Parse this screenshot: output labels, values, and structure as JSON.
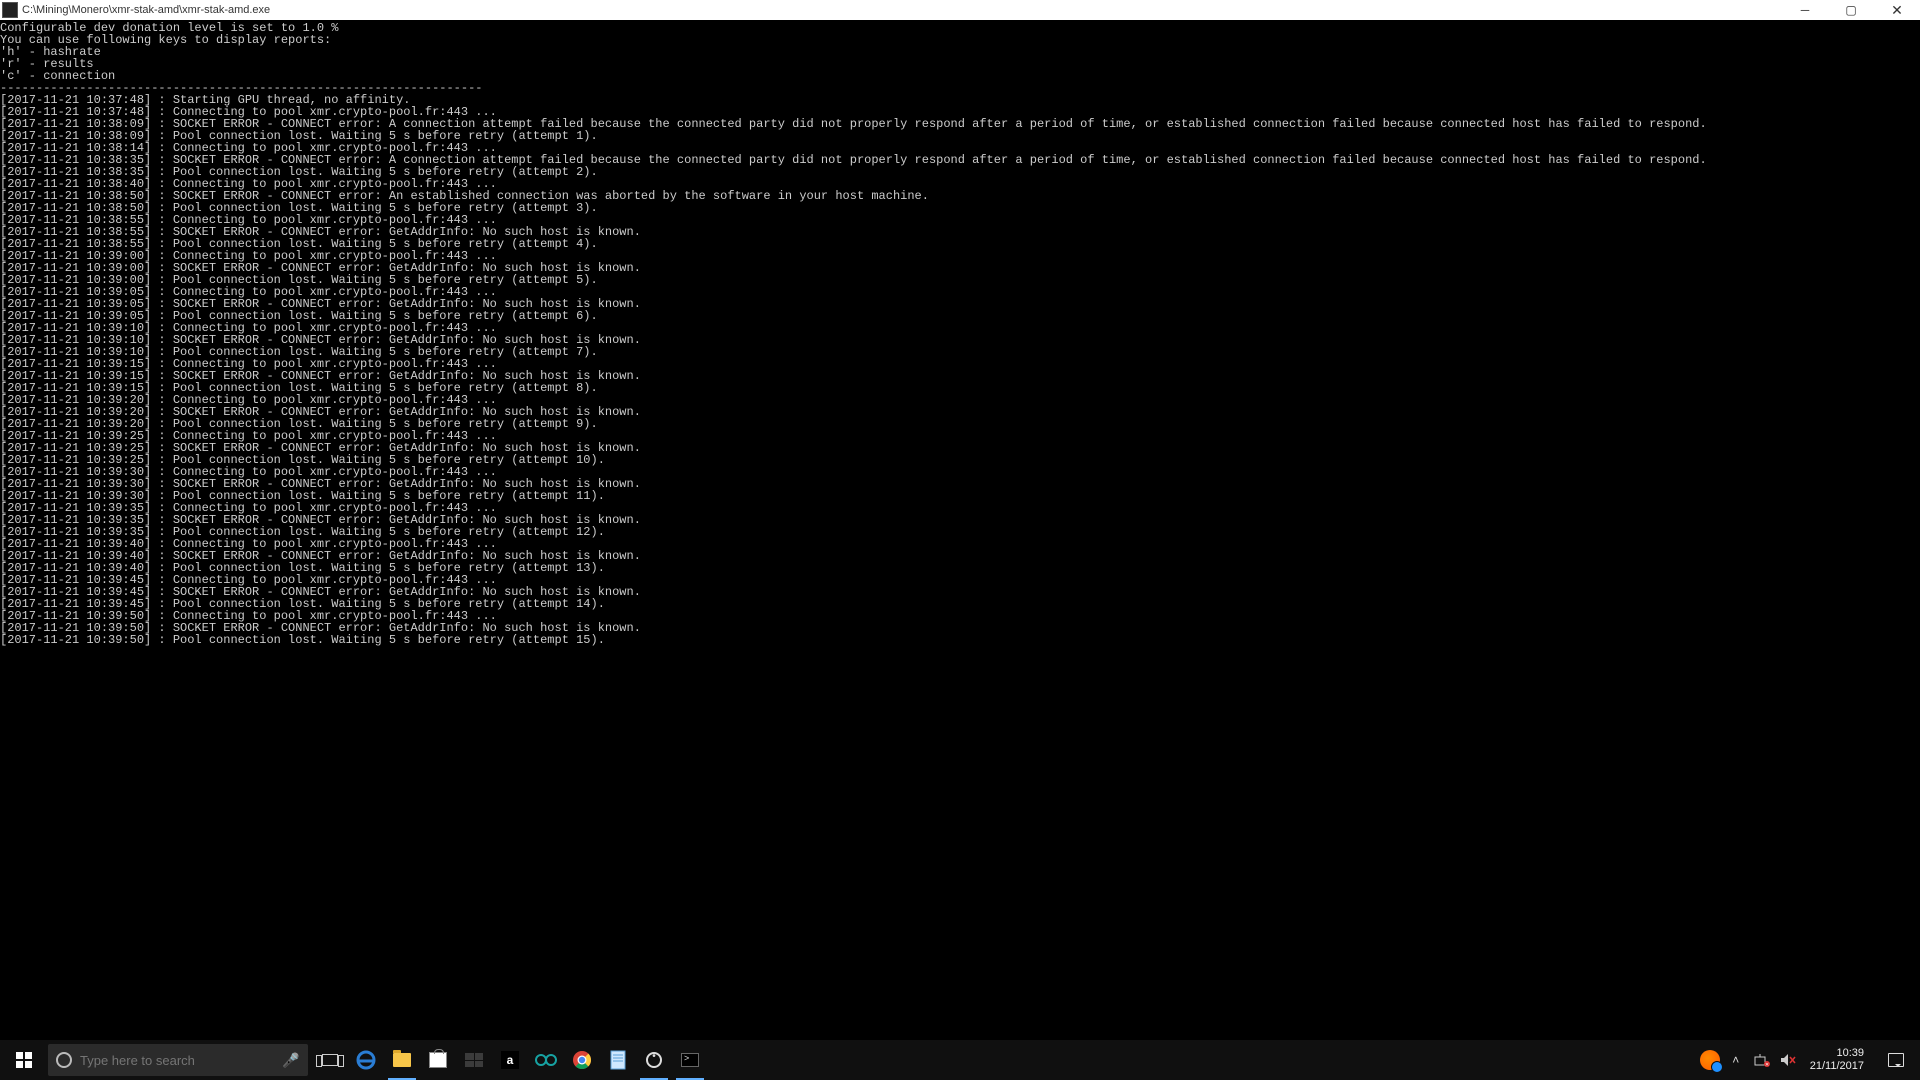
{
  "window": {
    "title": "C:\\Mining\\Monero\\xmr-stak-amd\\xmr-stak-amd.exe"
  },
  "console": {
    "header": [
      "Configurable dev donation level is set to 1.0 %",
      "",
      "You can use following keys to display reports:",
      "'h' - hashrate",
      "'r' - results",
      "'c' - connection",
      "-------------------------------------------------------------------"
    ],
    "log": [
      {
        "ts": "2017-11-21 10:37:48",
        "msg": "Starting GPU thread, no affinity."
      },
      {
        "ts": "2017-11-21 10:37:48",
        "msg": "Connecting to pool xmr.crypto-pool.fr:443 ..."
      },
      {
        "ts": "2017-11-21 10:38:09",
        "msg": "SOCKET ERROR - CONNECT error: A connection attempt failed because the connected party did not properly respond after a period of time, or established connection failed because connected host has failed to respond."
      },
      {
        "ts": "",
        "msg": ""
      },
      {
        "ts": "2017-11-21 10:38:09",
        "msg": "Pool connection lost. Waiting 5 s before retry (attempt 1)."
      },
      {
        "ts": "2017-11-21 10:38:14",
        "msg": "Connecting to pool xmr.crypto-pool.fr:443 ..."
      },
      {
        "ts": "2017-11-21 10:38:35",
        "msg": "SOCKET ERROR - CONNECT error: A connection attempt failed because the connected party did not properly respond after a period of time, or established connection failed because connected host has failed to respond."
      },
      {
        "ts": "",
        "msg": ""
      },
      {
        "ts": "2017-11-21 10:38:35",
        "msg": "Pool connection lost. Waiting 5 s before retry (attempt 2)."
      },
      {
        "ts": "2017-11-21 10:38:40",
        "msg": "Connecting to pool xmr.crypto-pool.fr:443 ..."
      },
      {
        "ts": "2017-11-21 10:38:50",
        "msg": "SOCKET ERROR - CONNECT error: An established connection was aborted by the software in your host machine."
      },
      {
        "ts": "2017-11-21 10:38:50",
        "msg": "Pool connection lost. Waiting 5 s before retry (attempt 3)."
      },
      {
        "ts": "2017-11-21 10:38:55",
        "msg": "Connecting to pool xmr.crypto-pool.fr:443 ..."
      },
      {
        "ts": "2017-11-21 10:38:55",
        "msg": "SOCKET ERROR - CONNECT error: GetAddrInfo: No such host is known."
      },
      {
        "ts": "2017-11-21 10:38:55",
        "msg": "Pool connection lost. Waiting 5 s before retry (attempt 4)."
      },
      {
        "ts": "2017-11-21 10:39:00",
        "msg": "Connecting to pool xmr.crypto-pool.fr:443 ..."
      },
      {
        "ts": "2017-11-21 10:39:00",
        "msg": "SOCKET ERROR - CONNECT error: GetAddrInfo: No such host is known."
      },
      {
        "ts": "2017-11-21 10:39:00",
        "msg": "Pool connection lost. Waiting 5 s before retry (attempt 5)."
      },
      {
        "ts": "2017-11-21 10:39:05",
        "msg": "Connecting to pool xmr.crypto-pool.fr:443 ..."
      },
      {
        "ts": "2017-11-21 10:39:05",
        "msg": "SOCKET ERROR - CONNECT error: GetAddrInfo: No such host is known."
      },
      {
        "ts": "2017-11-21 10:39:05",
        "msg": "Pool connection lost. Waiting 5 s before retry (attempt 6)."
      },
      {
        "ts": "2017-11-21 10:39:10",
        "msg": "Connecting to pool xmr.crypto-pool.fr:443 ..."
      },
      {
        "ts": "2017-11-21 10:39:10",
        "msg": "SOCKET ERROR - CONNECT error: GetAddrInfo: No such host is known."
      },
      {
        "ts": "2017-11-21 10:39:10",
        "msg": "Pool connection lost. Waiting 5 s before retry (attempt 7)."
      },
      {
        "ts": "2017-11-21 10:39:15",
        "msg": "Connecting to pool xmr.crypto-pool.fr:443 ..."
      },
      {
        "ts": "2017-11-21 10:39:15",
        "msg": "SOCKET ERROR - CONNECT error: GetAddrInfo: No such host is known."
      },
      {
        "ts": "2017-11-21 10:39:15",
        "msg": "Pool connection lost. Waiting 5 s before retry (attempt 8)."
      },
      {
        "ts": "2017-11-21 10:39:20",
        "msg": "Connecting to pool xmr.crypto-pool.fr:443 ..."
      },
      {
        "ts": "2017-11-21 10:39:20",
        "msg": "SOCKET ERROR - CONNECT error: GetAddrInfo: No such host is known."
      },
      {
        "ts": "2017-11-21 10:39:20",
        "msg": "Pool connection lost. Waiting 5 s before retry (attempt 9)."
      },
      {
        "ts": "2017-11-21 10:39:25",
        "msg": "Connecting to pool xmr.crypto-pool.fr:443 ..."
      },
      {
        "ts": "2017-11-21 10:39:25",
        "msg": "SOCKET ERROR - CONNECT error: GetAddrInfo: No such host is known."
      },
      {
        "ts": "2017-11-21 10:39:25",
        "msg": "Pool connection lost. Waiting 5 s before retry (attempt 10)."
      },
      {
        "ts": "2017-11-21 10:39:30",
        "msg": "Connecting to pool xmr.crypto-pool.fr:443 ..."
      },
      {
        "ts": "2017-11-21 10:39:30",
        "msg": "SOCKET ERROR - CONNECT error: GetAddrInfo: No such host is known."
      },
      {
        "ts": "2017-11-21 10:39:30",
        "msg": "Pool connection lost. Waiting 5 s before retry (attempt 11)."
      },
      {
        "ts": "2017-11-21 10:39:35",
        "msg": "Connecting to pool xmr.crypto-pool.fr:443 ..."
      },
      {
        "ts": "2017-11-21 10:39:35",
        "msg": "SOCKET ERROR - CONNECT error: GetAddrInfo: No such host is known."
      },
      {
        "ts": "2017-11-21 10:39:35",
        "msg": "Pool connection lost. Waiting 5 s before retry (attempt 12)."
      },
      {
        "ts": "2017-11-21 10:39:40",
        "msg": "Connecting to pool xmr.crypto-pool.fr:443 ..."
      },
      {
        "ts": "2017-11-21 10:39:40",
        "msg": "SOCKET ERROR - CONNECT error: GetAddrInfo: No such host is known."
      },
      {
        "ts": "2017-11-21 10:39:40",
        "msg": "Pool connection lost. Waiting 5 s before retry (attempt 13)."
      },
      {
        "ts": "2017-11-21 10:39:45",
        "msg": "Connecting to pool xmr.crypto-pool.fr:443 ..."
      },
      {
        "ts": "2017-11-21 10:39:45",
        "msg": "SOCKET ERROR - CONNECT error: GetAddrInfo: No such host is known."
      },
      {
        "ts": "2017-11-21 10:39:45",
        "msg": "Pool connection lost. Waiting 5 s before retry (attempt 14)."
      },
      {
        "ts": "2017-11-21 10:39:50",
        "msg": "Connecting to pool xmr.crypto-pool.fr:443 ..."
      },
      {
        "ts": "2017-11-21 10:39:50",
        "msg": "SOCKET ERROR - CONNECT error: GetAddrInfo: No such host is known."
      },
      {
        "ts": "2017-11-21 10:39:50",
        "msg": "Pool connection lost. Waiting 5 s before retry (attempt 15)."
      }
    ]
  },
  "taskbar": {
    "search_placeholder": "Type here to search",
    "apps": [
      {
        "name": "task-view",
        "active": false
      },
      {
        "name": "edge",
        "active": false
      },
      {
        "name": "file-explorer",
        "active": true
      },
      {
        "name": "microsoft-store",
        "active": false
      },
      {
        "name": "dropbox",
        "active": false
      },
      {
        "name": "amazon",
        "active": false
      },
      {
        "name": "arduino",
        "active": false
      },
      {
        "name": "chrome",
        "active": false
      },
      {
        "name": "notepad",
        "active": false
      },
      {
        "name": "settings",
        "active": true
      },
      {
        "name": "command-prompt",
        "active": true
      }
    ],
    "tray": {
      "items": [
        "avast",
        "chevron-up",
        "network-error",
        "volume-mute"
      ],
      "time": "10:39",
      "date": "21/11/2017"
    }
  }
}
